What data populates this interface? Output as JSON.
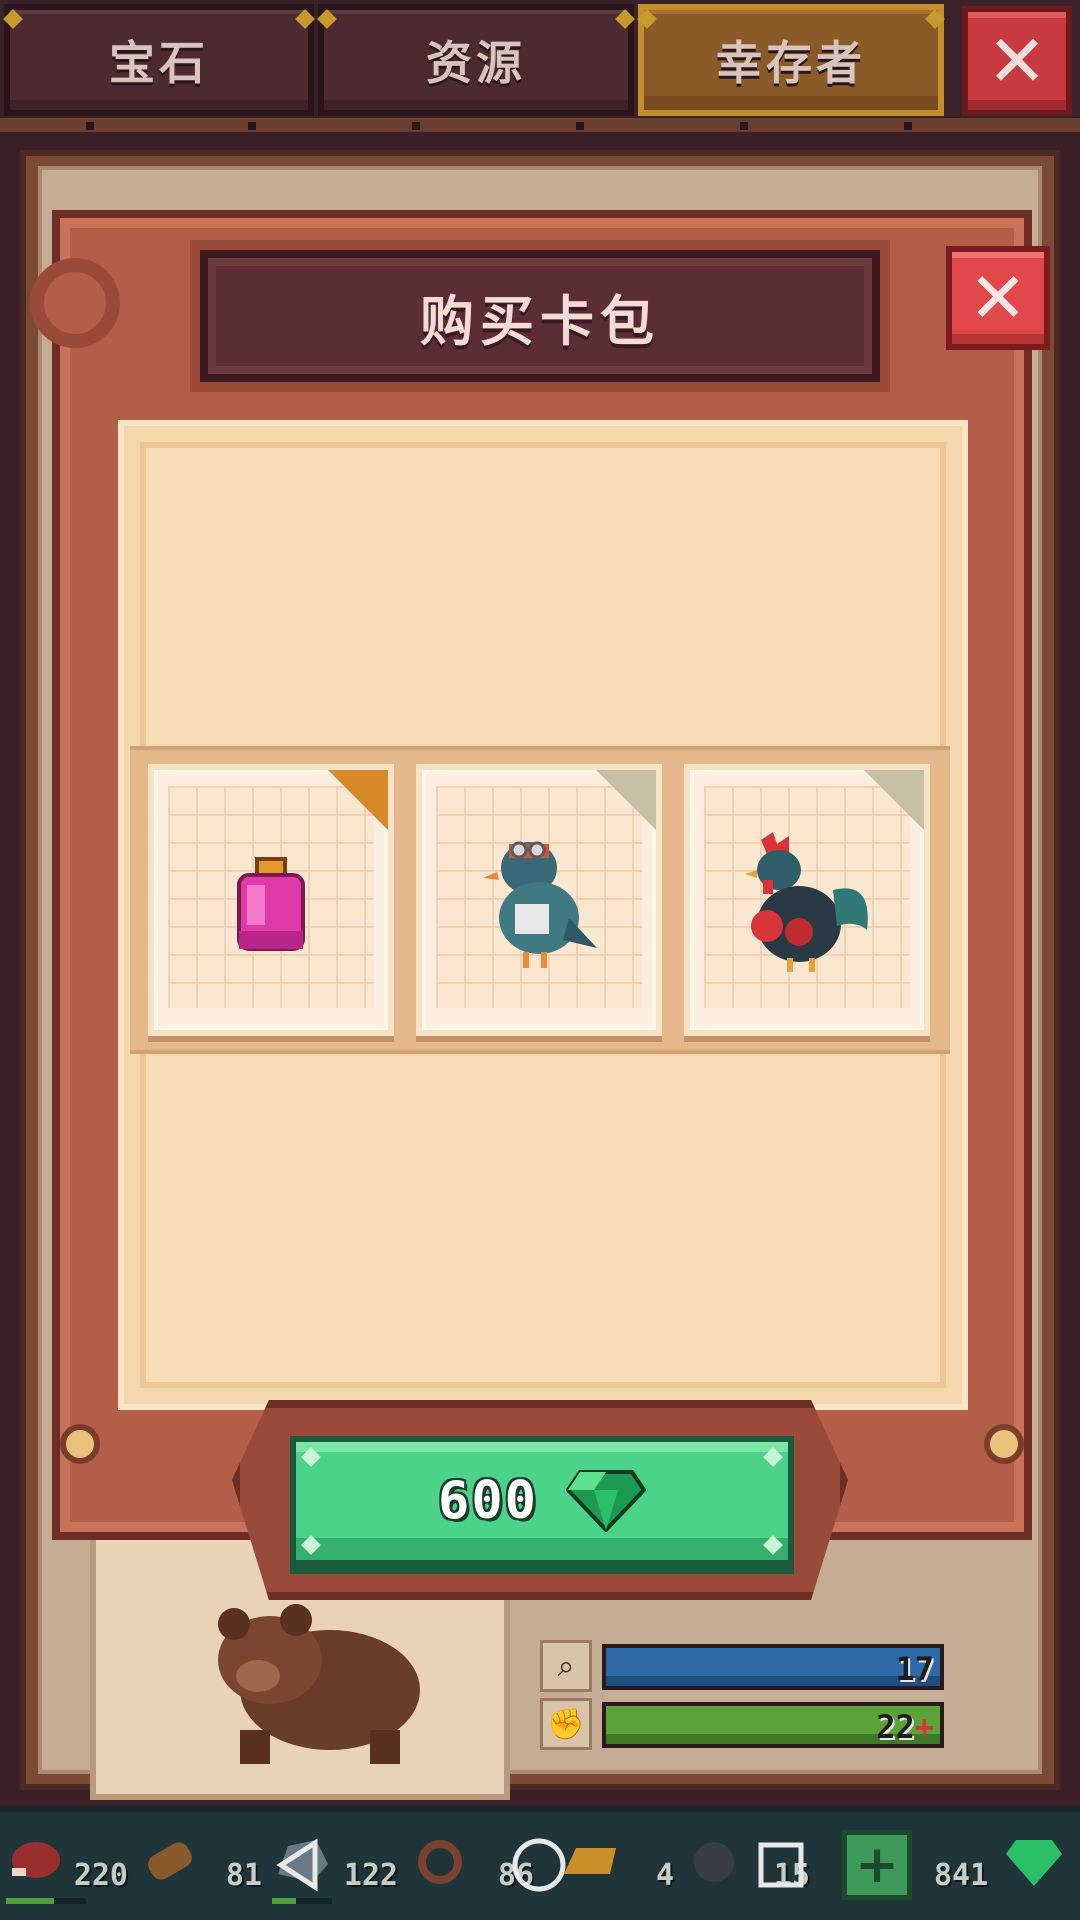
{
  "tabs": [
    {
      "label": "宝石",
      "active": false
    },
    {
      "label": "资源",
      "active": false
    },
    {
      "label": "幸存者",
      "active": true
    }
  ],
  "top_close_icon": "close-icon",
  "dialog": {
    "title": "购买卡包",
    "close_icon": "close-icon",
    "cards": [
      {
        "item": "pink-potion",
        "rarity": "gold"
      },
      {
        "item": "pigeon-survivor",
        "rarity": "silver"
      },
      {
        "item": "rooster-survivor",
        "rarity": "silver"
      }
    ],
    "buy_button": {
      "price": "600",
      "currency_icon": "gem-icon"
    }
  },
  "background_card": {
    "survivor": "bear",
    "stats": [
      {
        "icon": "search-icon",
        "value": "17",
        "bar_color": "#2f6aa8"
      },
      {
        "icon": "strength-icon",
        "value": "22",
        "bonus": "+",
        "bar_color": "#5aa33a"
      }
    ]
  },
  "resources": [
    {
      "icon": "meat-icon",
      "value": "220"
    },
    {
      "icon": "wood-icon",
      "value": "81"
    },
    {
      "icon": "stone-icon",
      "value": "122"
    },
    {
      "icon": "rope-icon",
      "value": "86"
    },
    {
      "icon": "gold-bar-icon",
      "value": "4"
    },
    {
      "icon": "coal-icon",
      "value": "15"
    },
    {
      "icon": "gem-icon",
      "value": "841"
    }
  ],
  "add_icon": "plus-icon",
  "nav": {
    "back": "back-icon",
    "home": "home-icon",
    "recents": "recents-icon"
  },
  "colors": {
    "accent_green": "#4bd389",
    "close_red": "#e0484b",
    "frame_brown": "#b35e48",
    "parchment": "#f6dcb4"
  }
}
